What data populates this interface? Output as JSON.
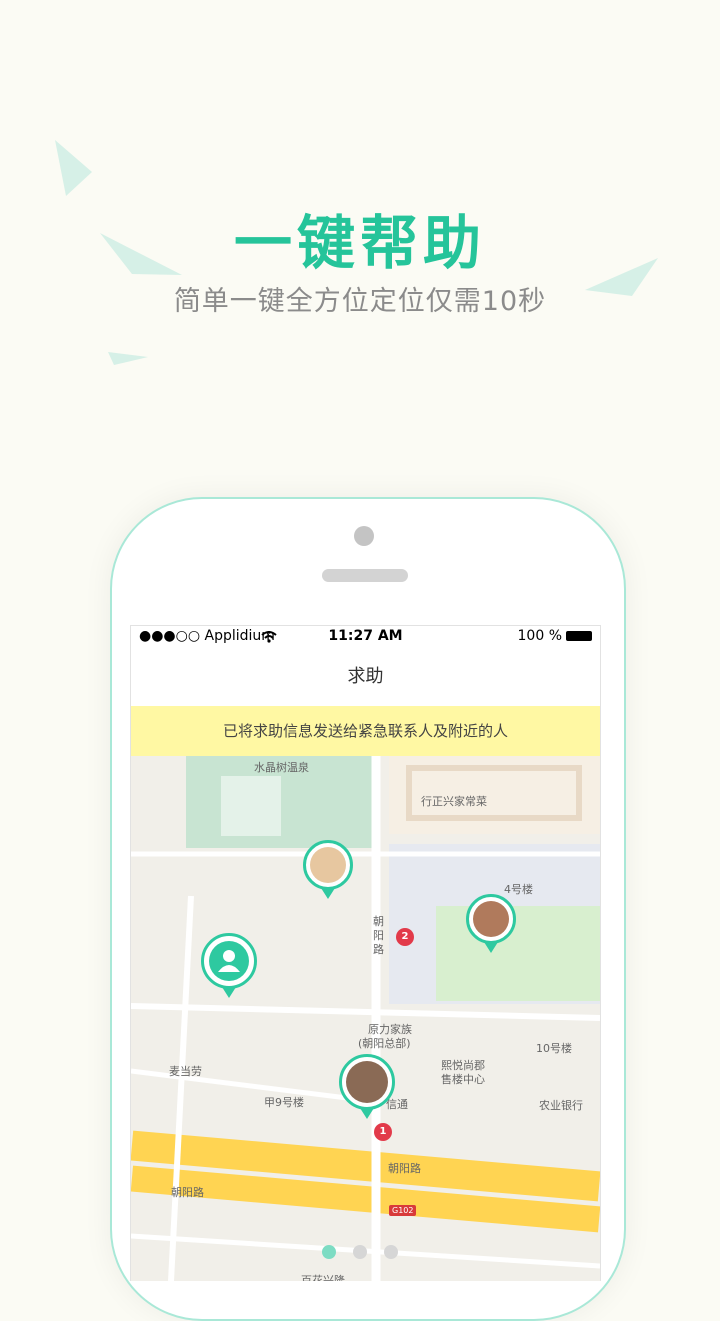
{
  "headline": "一键帮助",
  "subline": "简单一键全方位定位仅需10秒",
  "colors": {
    "accent": "#25c49a",
    "pin_border": "#2ec9a0",
    "notice_bg": "#fff8a3"
  },
  "status_bar": {
    "carrier": "●●●○○ Applidium",
    "wifi_icon": "wifi-icon",
    "time": "11:27 AM",
    "battery": "100 %"
  },
  "nav": {
    "title": "求助"
  },
  "notice": "已将求助信息发送给紧急联系人及附近的人",
  "map": {
    "labels": [
      "水晶树温泉",
      "行正兴家常菜",
      "4号楼",
      "朝",
      "阳",
      "路",
      "原力家族",
      "(朝阳总部)",
      "10号楼",
      "熙悦尚郡",
      "售楼中心",
      "麦当劳",
      "甲9号楼",
      "信通",
      "农业银行",
      "朝阳路",
      "朝阳路",
      "百花兴隆"
    ],
    "road_number": "G102",
    "markers": [
      "1",
      "2"
    ]
  },
  "pager": {
    "count": 3,
    "active": 0
  }
}
